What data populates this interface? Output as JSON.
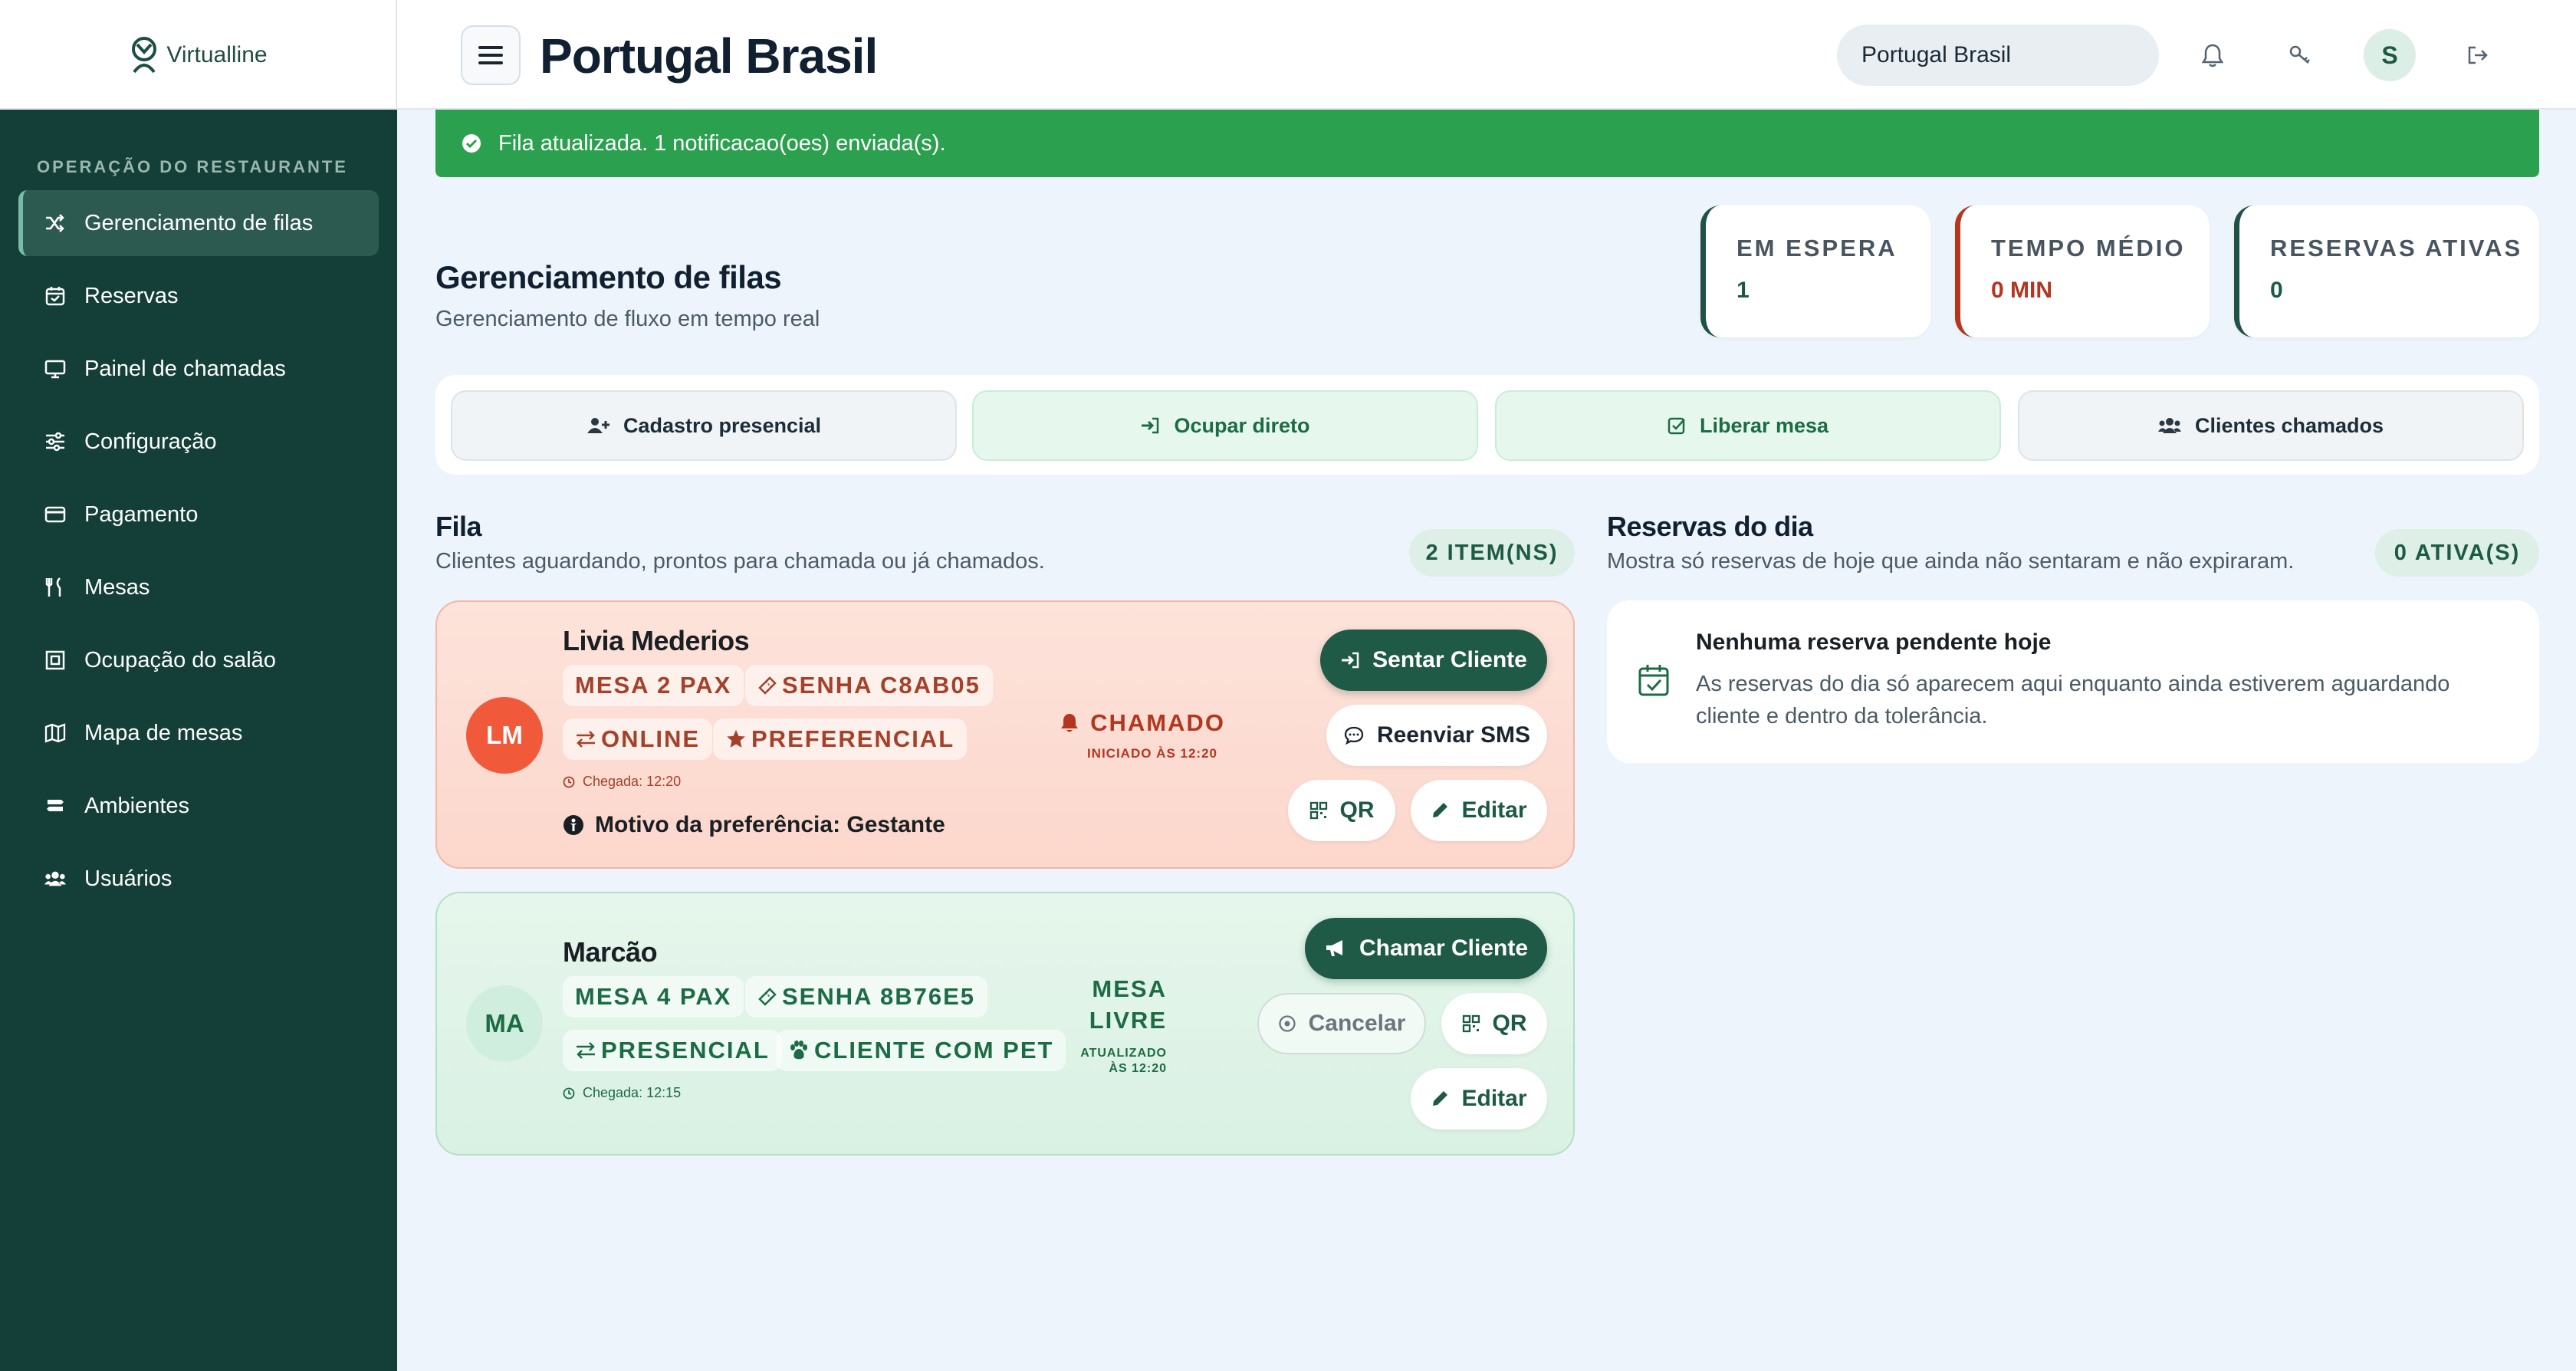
{
  "header": {
    "brand": "Virtualline",
    "title": "Portugal Brasil",
    "search_value": "Portugal Brasil",
    "avatar_initial": "S"
  },
  "sidebar": {
    "section": "OPERAÇÃO DO RESTAURANTE",
    "items": [
      {
        "label": "Gerenciamento de filas",
        "icon": "shuffle-icon",
        "active": true
      },
      {
        "label": "Reservas",
        "icon": "calendar-icon"
      },
      {
        "label": "Painel de chamadas",
        "icon": "monitor-icon"
      },
      {
        "label": "Configuração",
        "icon": "sliders-icon"
      },
      {
        "label": "Pagamento",
        "icon": "credit-card-icon"
      },
      {
        "label": "Mesas",
        "icon": "utensils-icon"
      },
      {
        "label": "Ocupação do salão",
        "icon": "floor-icon"
      },
      {
        "label": "Mapa de mesas",
        "icon": "map-icon"
      },
      {
        "label": "Ambientes",
        "icon": "signpost-icon"
      },
      {
        "label": "Usuários",
        "icon": "users-icon"
      }
    ]
  },
  "alert": "Fila atualizada. 1 notificacao(oes) enviada(s).",
  "main": {
    "title": "Gerenciamento de filas",
    "subtitle": "Gerenciamento de fluxo em tempo real",
    "stats": [
      {
        "label": "EM ESPERA",
        "value": "1"
      },
      {
        "label": "TEMPO MÉDIO",
        "value": "0 MIN"
      },
      {
        "label": "RESERVAS ATIVAS",
        "value": "0"
      }
    ],
    "actions": [
      "Cadastro presencial",
      "Ocupar direto",
      "Liberar mesa",
      "Clientes chamados"
    ]
  },
  "queue": {
    "title": "Fila",
    "subtitle": "Clientes aguardando, prontos para chamada ou já chamados.",
    "count": "2 ITEM(NS)",
    "cards": [
      {
        "initials": "LM",
        "name": "Livia Mederios",
        "tag_mesa": "MESA 2 PAX",
        "tag_senha": "SENHA C8AB05",
        "tag_origin": "ONLINE",
        "tag_extra": "PREFERENCIAL",
        "arrival": "Chegada: 12:20",
        "reason": "Motivo da preferência: Gestante",
        "status": "CHAMADO",
        "status_time": "INICIADO ÀS 12:20",
        "btn_primary": "Sentar Cliente",
        "btn_secondary": "Reenviar SMS",
        "btn_qr": "QR",
        "btn_edit": "Editar"
      },
      {
        "initials": "MA",
        "name": "Marcão",
        "tag_mesa": "MESA 4 PAX",
        "tag_senha": "SENHA 8B76E5",
        "tag_origin": "PRESENCIAL",
        "tag_extra": "CLIENTE COM PET",
        "arrival": "Chegada: 12:15",
        "status_line1": "MESA",
        "status_line2": "LIVRE",
        "status_time1": "ATUALIZADO",
        "status_time2": "ÀS 12:20",
        "btn_primary": "Chamar Cliente",
        "btn_cancel": "Cancelar",
        "btn_qr": "QR",
        "btn_edit": "Editar"
      }
    ]
  },
  "reservations": {
    "title": "Reservas do dia",
    "subtitle": "Mostra só reservas de hoje que ainda não sentaram e não expiraram.",
    "count": "0 ATIVA(S)",
    "empty_title": "Nenhuma reserva pendente hoje",
    "empty_text": "As reservas do dia só aparecem aqui enquanto ainda estiverem aguardando cliente e dentro da tolerância."
  },
  "colors": {
    "sidebar": "#143f38",
    "accent": "#1e5a45",
    "success": "#2ba04f",
    "danger": "#b3361f"
  }
}
